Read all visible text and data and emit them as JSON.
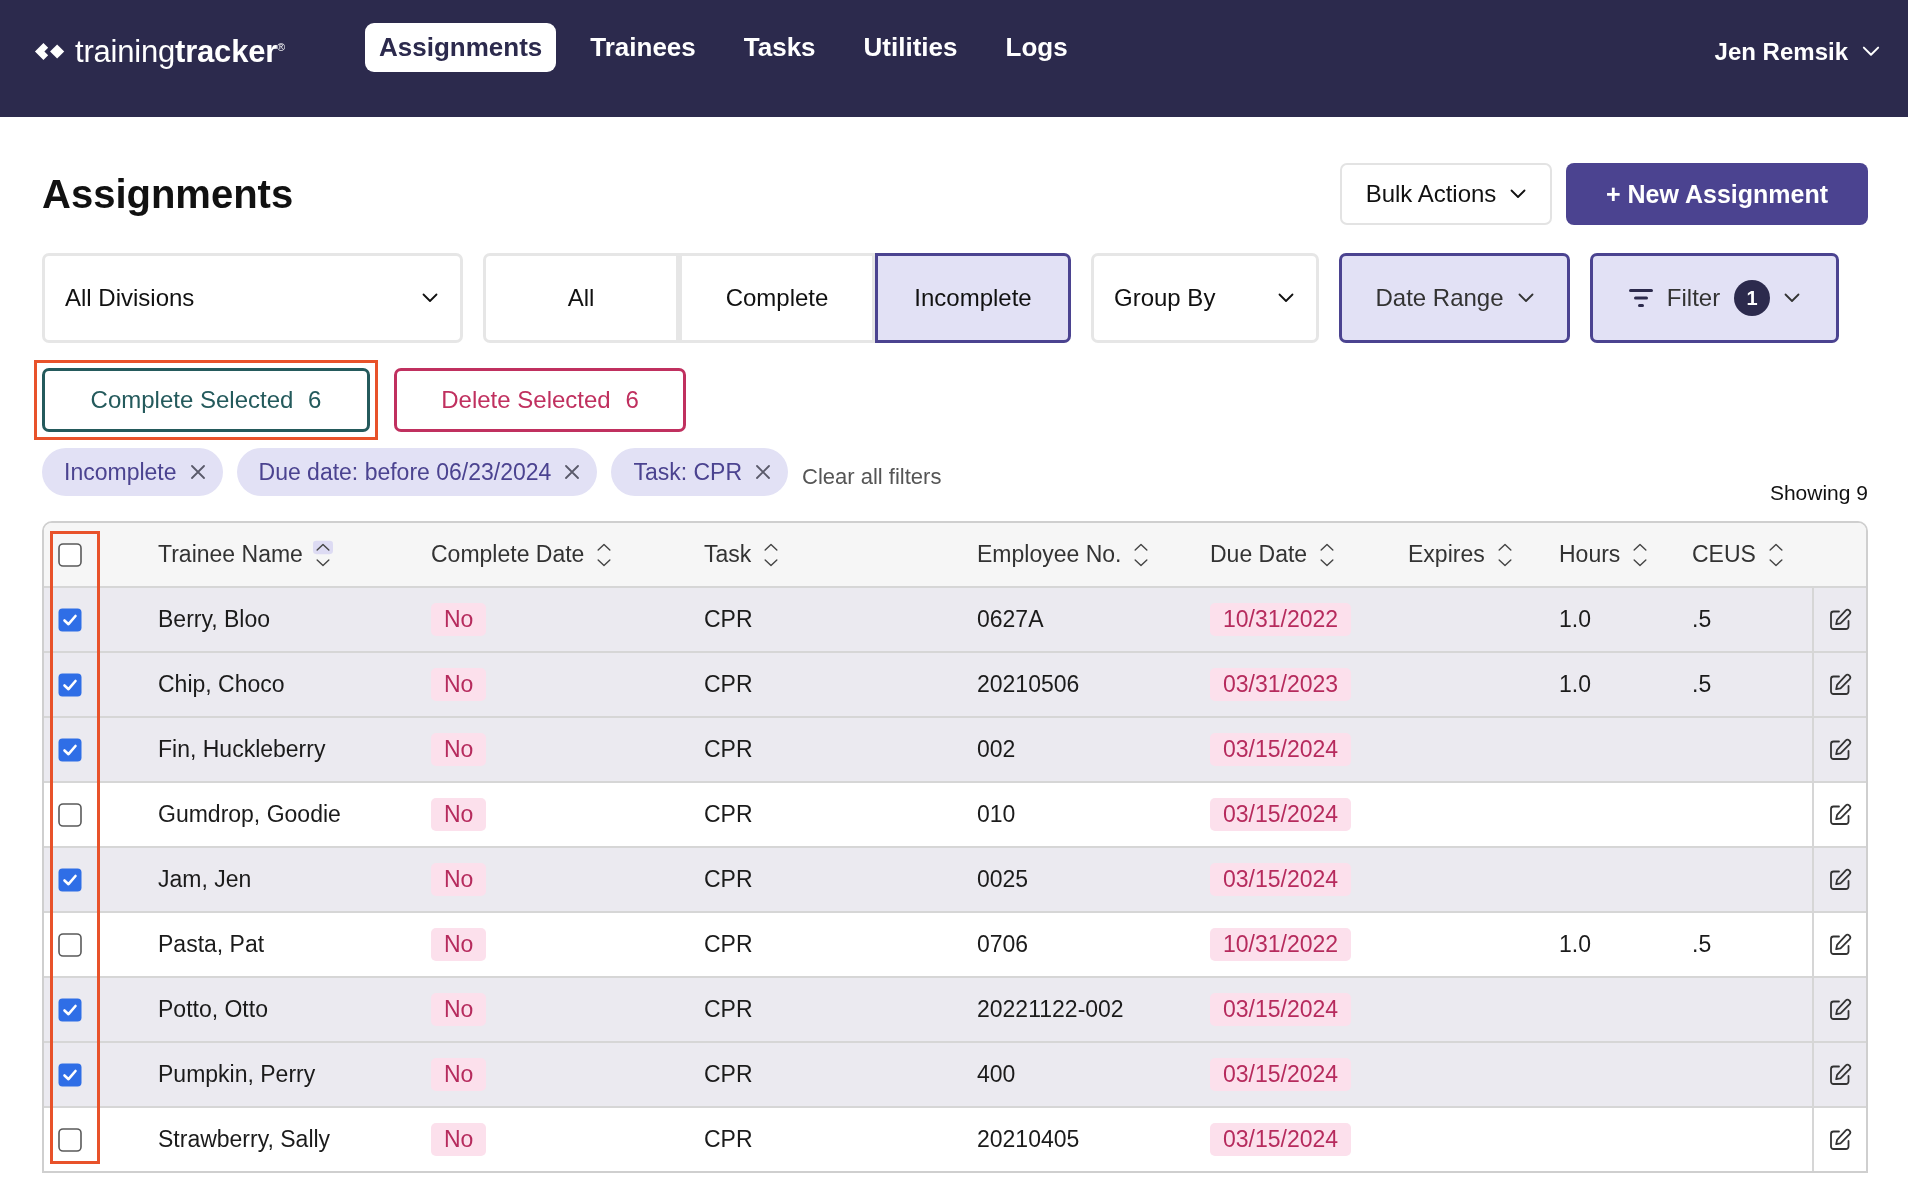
{
  "nav": {
    "logo": {
      "text": "training**tracker**$^{®}$"
    },
    "items": [
      {
        "label": "Assignments",
        "selected": true
      },
      {
        "label": "Trainees",
        "selected": false
      },
      {
        "label": "Tasks",
        "selected": false
      },
      {
        "label": "Utilities",
        "selected": false
      },
      {
        "label": "Logs",
        "selected": false
      }
    ],
    "user": {
      "name": "Jen Remsik"
    }
  },
  "page": {
    "title": "Assignments",
    "bulk_actions": {
      "label": "Bulk Actions"
    },
    "new_button": {
      "label": "+ New Assignment"
    }
  },
  "filters": {
    "division": {
      "value": "All Divisions"
    },
    "status_tabs": [
      {
        "label": "All",
        "selected": false
      },
      {
        "label": "Complete",
        "selected": false
      },
      {
        "label": "Incomplete",
        "selected": true
      }
    ],
    "dropdowns": [
      {
        "kind": "group_by",
        "label": "Group By",
        "active": false
      },
      {
        "kind": "date_range",
        "label": "Date Range",
        "active": true
      },
      {
        "kind": "filter",
        "label": "Filter",
        "count": "1",
        "active": true
      }
    ]
  },
  "actions": [
    {
      "kind": "complete",
      "label": "Complete Selected",
      "count": "6",
      "highlighted": true
    },
    {
      "kind": "delete",
      "label": "Delete Selected",
      "count": "6",
      "highlighted": false
    }
  ],
  "chips": [
    {
      "label": "Incomplete"
    },
    {
      "label": "Due date: before 06/23/2024"
    },
    {
      "label": "Task: CPR"
    }
  ],
  "clear_filters": {
    "label": "Clear all filters"
  },
  "results": {
    "label": "Showing 9"
  },
  "table": {
    "select_all": {
      "checked": false
    },
    "checkbox_column_highlighted": true,
    "columns": [
      {
        "label": "Trainee Name",
        "sorted_ascending": true
      },
      {
        "label": "Complete Date",
        "sorted_ascending": false
      },
      {
        "label": "Task",
        "sorted_ascending": false
      },
      {
        "label": "Employee No.",
        "sorted_ascending": false
      },
      {
        "label": "Due Date",
        "sorted_ascending": false
      },
      {
        "label": "Expires",
        "sorted_ascending": false
      },
      {
        "label": "Hours",
        "sorted_ascending": false
      },
      {
        "label": "CEUS",
        "sorted_ascending": false
      }
    ],
    "rows": [
      {
        "selected": true,
        "trainee_name": "Berry, Bloo",
        "complete_date": "No",
        "task": "CPR",
        "employee_no": "0627A",
        "due_date": "10/31/2022",
        "hours": "1.0",
        "ceus": ".5"
      },
      {
        "selected": true,
        "trainee_name": "Chip, Choco",
        "complete_date": "No",
        "task": "CPR",
        "employee_no": "20210506",
        "due_date": "03/31/2023",
        "hours": "1.0",
        "ceus": ".5"
      },
      {
        "selected": true,
        "trainee_name": "Fin, Huckleberry",
        "complete_date": "No",
        "task": "CPR",
        "employee_no": "002",
        "due_date": "03/15/2024"
      },
      {
        "selected": false,
        "trainee_name": "Gumdrop, Goodie",
        "complete_date": "No",
        "task": "CPR",
        "employee_no": "010",
        "due_date": "03/15/2024"
      },
      {
        "selected": true,
        "trainee_name": "Jam, Jen",
        "complete_date": "No",
        "task": "CPR",
        "employee_no": "0025",
        "due_date": "03/15/2024"
      },
      {
        "selected": false,
        "trainee_name": "Pasta, Pat",
        "complete_date": "No",
        "task": "CPR",
        "employee_no": "0706",
        "due_date": "10/31/2022",
        "hours": "1.0",
        "ceus": ".5"
      },
      {
        "selected": true,
        "trainee_name": "Potto, Otto",
        "complete_date": "No",
        "task": "CPR",
        "employee_no": "20221122-002",
        "due_date": "03/15/2024"
      },
      {
        "selected": true,
        "trainee_name": "Pumpkin, Perry",
        "complete_date": "No",
        "task": "CPR",
        "employee_no": "400",
        "due_date": "03/15/2024"
      },
      {
        "selected": false,
        "trainee_name": "Strawberry, Sally",
        "complete_date": "No",
        "task": "CPR",
        "employee_no": "20210405",
        "due_date": "03/15/2024"
      }
    ]
  }
}
